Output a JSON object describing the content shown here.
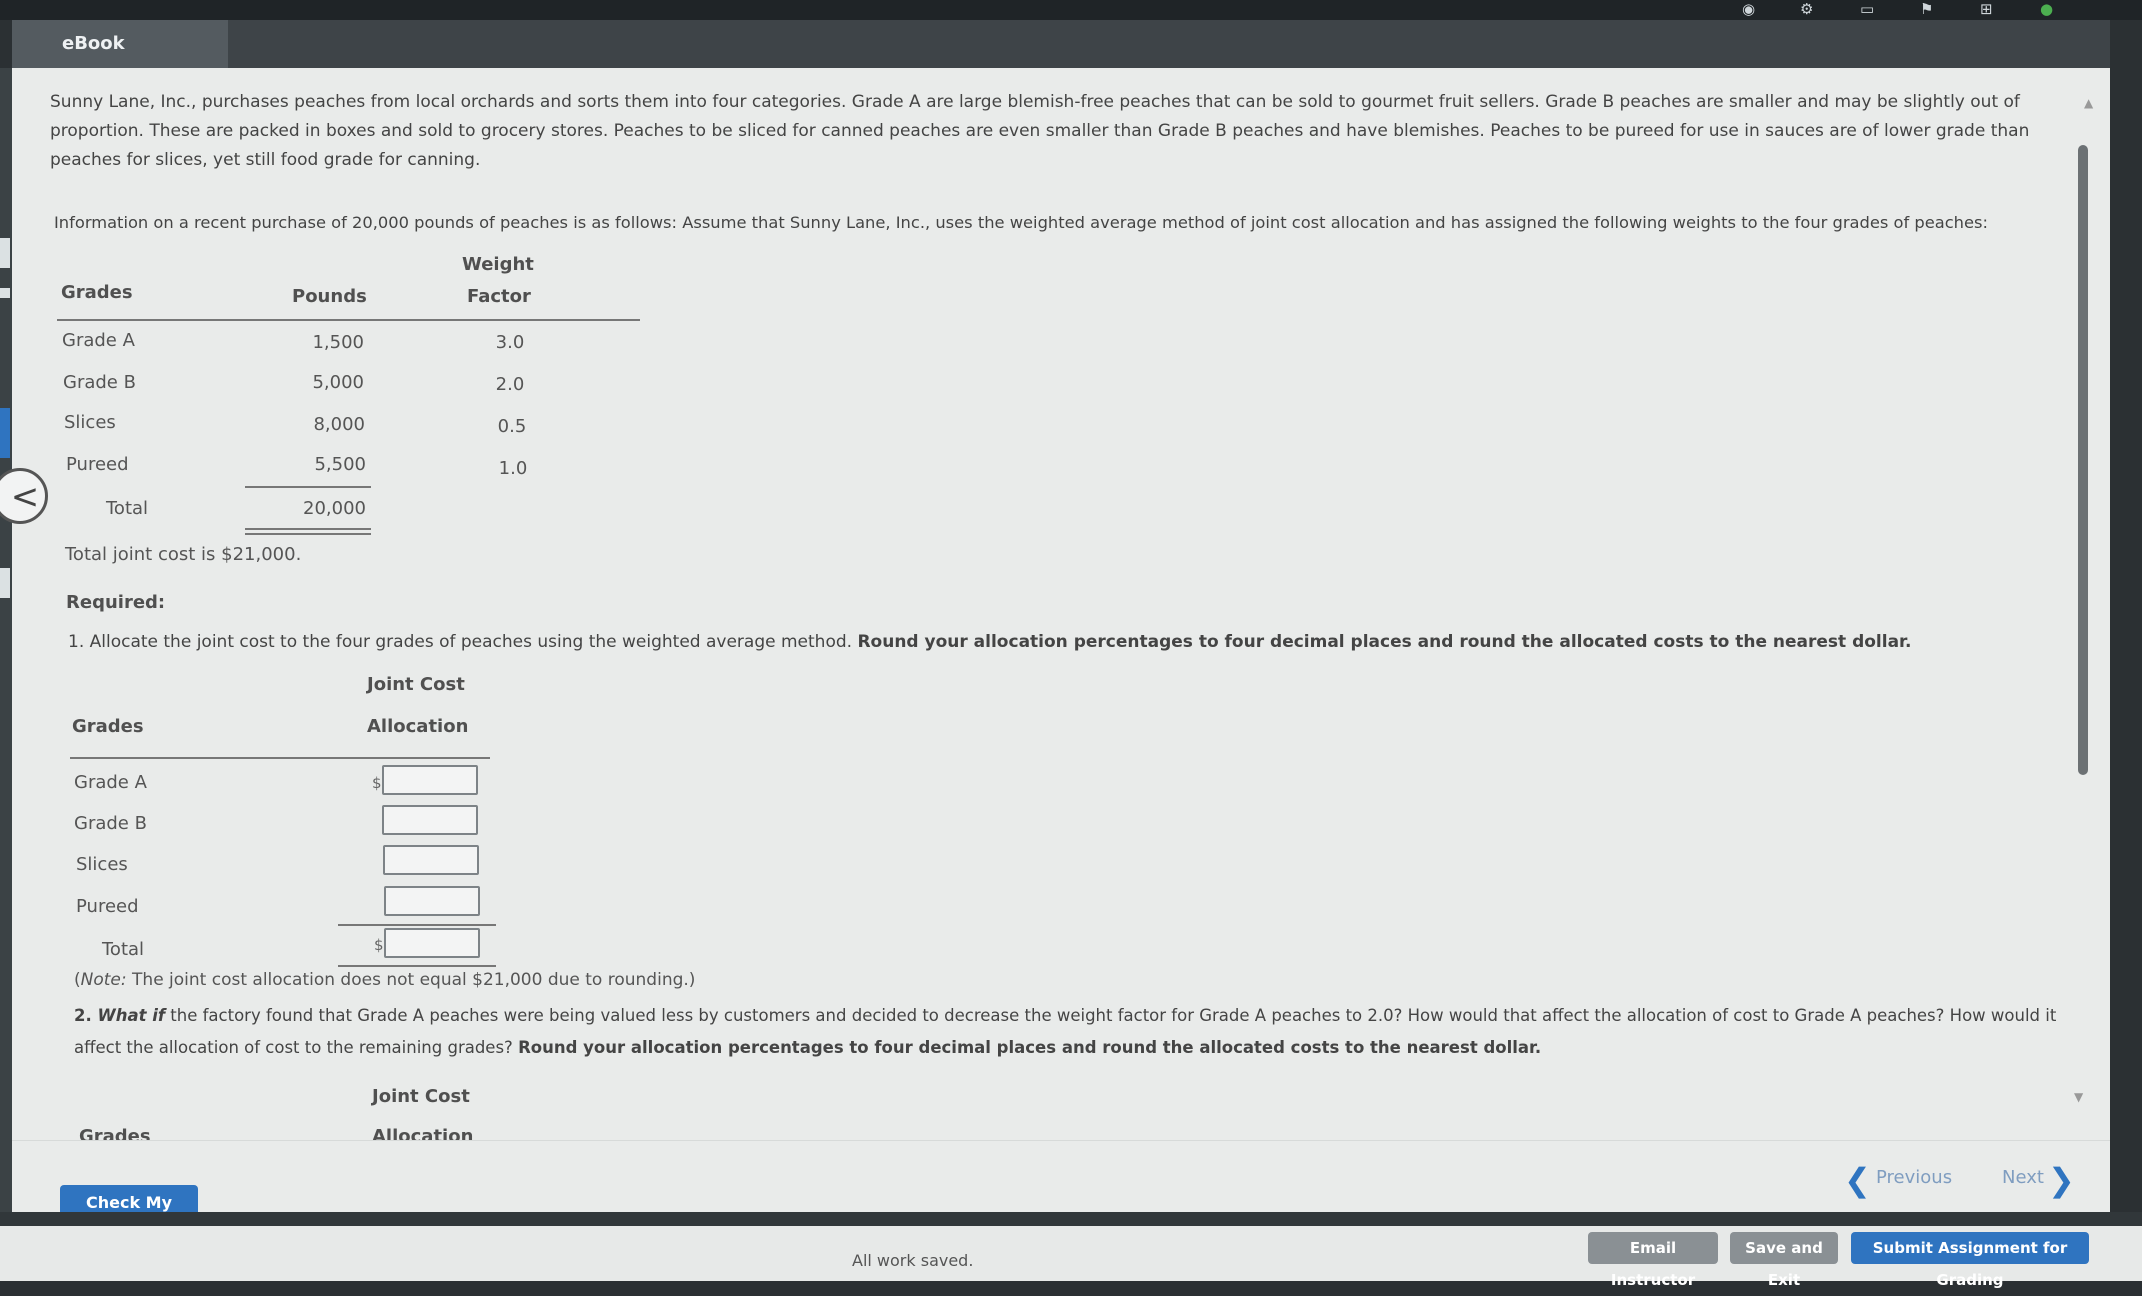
{
  "tab": {
    "label": "eBook"
  },
  "intro": {
    "p1": "Sunny Lane, Inc., purchases peaches from local orchards and sorts them into four categories. Grade A are large blemish-free peaches that can be sold to gourmet fruit sellers. Grade B peaches are smaller and may be slightly out of proportion. These are packed in boxes and sold to grocery stores. Peaches to be sliced for canned peaches are even smaller than Grade B peaches and have blemishes. Peaches to be pureed for use in sauces are of lower grade than peaches for slices, yet still food grade for canning.",
    "p2": "Information on a recent purchase of 20,000 pounds of peaches is as follows: Assume that Sunny Lane, Inc., uses the weighted average method of joint cost allocation and has assigned the following weights to the four grades of peaches:"
  },
  "info_table": {
    "headers": {
      "grades": "Grades",
      "pounds": "Pounds",
      "weight_line1": "Weight",
      "weight_line2": "Factor"
    },
    "rows": [
      {
        "grade": "Grade A",
        "pounds": "1,500",
        "weight": "3.0"
      },
      {
        "grade": "Grade B",
        "pounds": "5,000",
        "weight": "2.0"
      },
      {
        "grade": "Slices",
        "pounds": "8,000",
        "weight": "0.5"
      },
      {
        "grade": "Pureed",
        "pounds": "5,500",
        "weight": "1.0"
      }
    ],
    "total_label": "Total",
    "total_pounds": "20,000"
  },
  "joint_cost_text": "Total joint cost is $21,000.",
  "required_label": "Required:",
  "q1": {
    "text": "1. Allocate the joint cost to the four grades of peaches using the weighted average method.",
    "bold": "Round your allocation percentages to four decimal places and round the allocated costs to the nearest dollar."
  },
  "alloc_table": {
    "header_grades": "Grades",
    "header_line1": "Joint Cost",
    "header_line2": "Allocation",
    "rows": [
      "Grade A",
      "Grade B",
      "Slices",
      "Pureed"
    ],
    "total_label": "Total",
    "currency": "$"
  },
  "note": {
    "label": "Note:",
    "text": " The joint cost allocation does not equal $21,000 due to rounding.)"
  },
  "q2": {
    "prefix": "2. ",
    "what_if": "What if",
    "text": " the factory found that Grade A peaches were being valued less by customers and decided to decrease the weight factor for Grade A peaches to 2.0? How would that affect the allocation of cost to Grade A peaches? How would it affect the allocation of cost to the remaining grades?",
    "bold": "Round your allocation percentages to four decimal places and round the allocated costs to the nearest dollar."
  },
  "q2_table": {
    "header_grades": "Grades",
    "header_line1": "Joint Cost",
    "header_line2": "Allocation"
  },
  "buttons": {
    "check": "Check My Work",
    "previous": "Previous",
    "next": "Next",
    "email": "Email Instructor",
    "save_exit": "Save and Exit",
    "submit": "Submit Assignment for Grading"
  },
  "status": {
    "saved": "All work saved."
  },
  "colors": {
    "accent": "#2f74c0",
    "page_bg": "#e9ebea",
    "chrome": "#3e4448"
  }
}
